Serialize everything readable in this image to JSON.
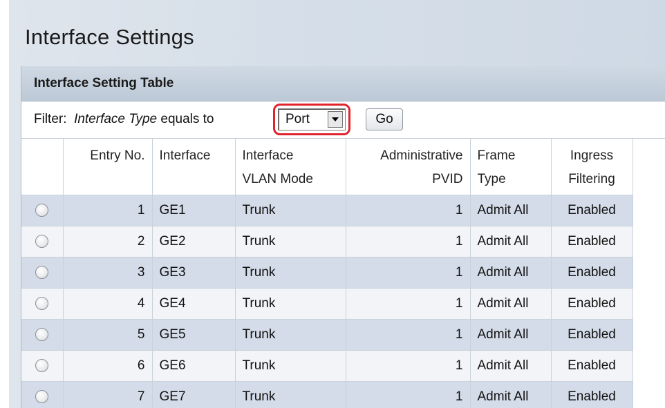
{
  "page": {
    "title": "Interface Settings"
  },
  "table": {
    "title": "Interface Setting Table",
    "filter": {
      "prefix": "Filter:",
      "field": "Interface Type",
      "suffix": "equals to",
      "selected": "Port",
      "go_label": "Go"
    },
    "columns": [
      {
        "line1": "",
        "line2": ""
      },
      {
        "line1": "Entry No.",
        "line2": ""
      },
      {
        "line1": "Interface",
        "line2": ""
      },
      {
        "line1": "Interface",
        "line2": "VLAN Mode"
      },
      {
        "line1": "Administrative",
        "line2": "PVID"
      },
      {
        "line1": "Frame",
        "line2": "Type"
      },
      {
        "line1": "Ingress",
        "line2": "Filtering"
      }
    ],
    "rows": [
      {
        "entry": "1",
        "interface": "GE1",
        "mode": "Trunk",
        "pvid": "1",
        "frame": "Admit All",
        "ingress": "Enabled"
      },
      {
        "entry": "2",
        "interface": "GE2",
        "mode": "Trunk",
        "pvid": "1",
        "frame": "Admit All",
        "ingress": "Enabled"
      },
      {
        "entry": "3",
        "interface": "GE3",
        "mode": "Trunk",
        "pvid": "1",
        "frame": "Admit All",
        "ingress": "Enabled"
      },
      {
        "entry": "4",
        "interface": "GE4",
        "mode": "Trunk",
        "pvid": "1",
        "frame": "Admit All",
        "ingress": "Enabled"
      },
      {
        "entry": "5",
        "interface": "GE5",
        "mode": "Trunk",
        "pvid": "1",
        "frame": "Admit All",
        "ingress": "Enabled"
      },
      {
        "entry": "6",
        "interface": "GE6",
        "mode": "Trunk",
        "pvid": "1",
        "frame": "Admit All",
        "ingress": "Enabled"
      },
      {
        "entry": "7",
        "interface": "GE7",
        "mode": "Trunk",
        "pvid": "1",
        "frame": "Admit All",
        "ingress": "Enabled"
      }
    ]
  },
  "colors": {
    "highlight": "#e0232c",
    "row_odd": "#d3dce8",
    "row_even": "#f2f4f7",
    "header": "#c5d1dd"
  }
}
